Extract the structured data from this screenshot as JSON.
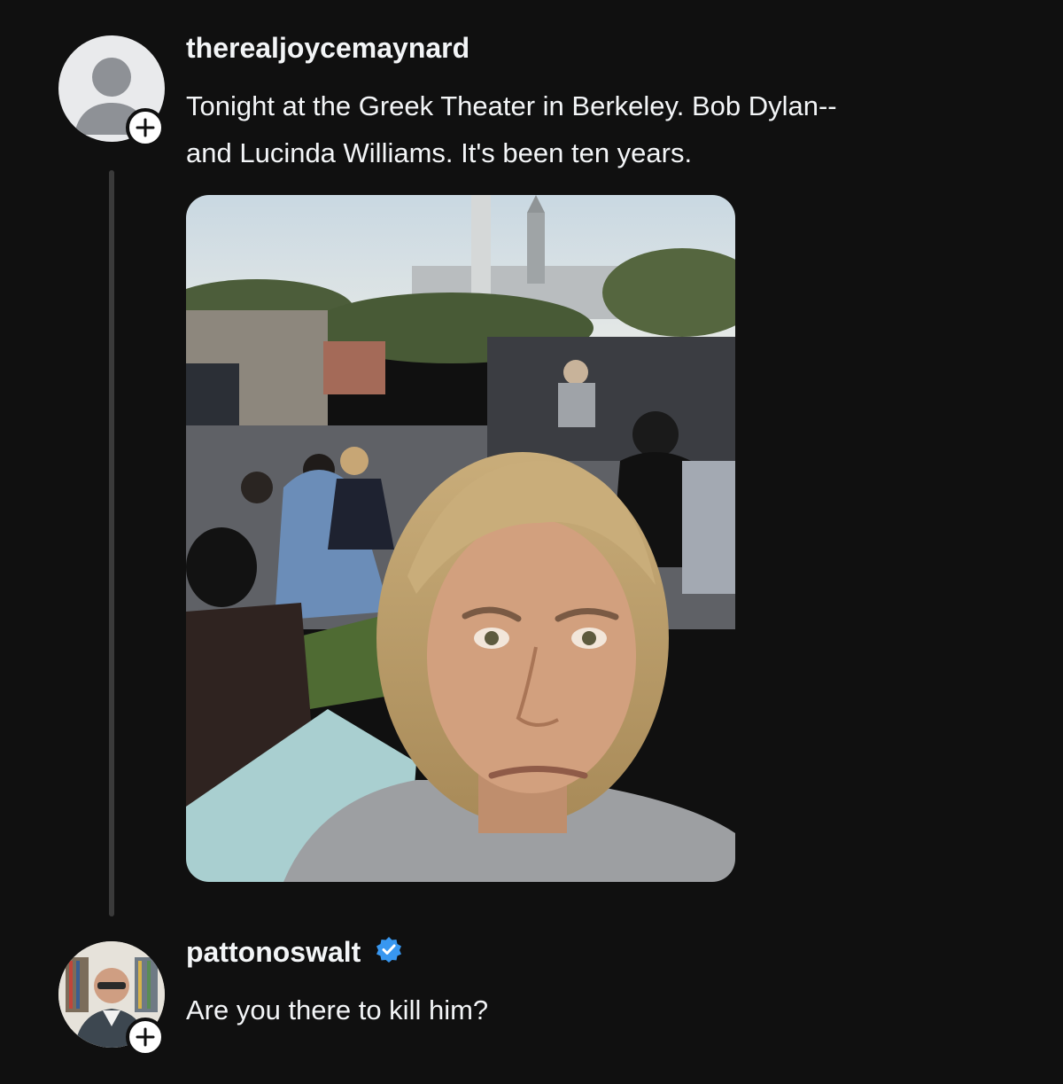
{
  "thread": {
    "original_post": {
      "username": "therealjoycemaynard",
      "text_lines": [
        "Tonight at the Greek Theater in Berkeley. Bob Dylan--",
        "and Lucinda Williams. It's been ten years."
      ],
      "avatar_icon": "default-user-avatar-icon",
      "follow_icon": "plus-icon"
    },
    "reply": {
      "username": "pattonoswalt",
      "verified_icon": "verified-badge-icon",
      "verified_color": "#3897f0",
      "text": "Are you there to kill him?",
      "follow_icon": "plus-icon"
    }
  },
  "colors": {
    "background": "#101010",
    "text": "#f3f5f7",
    "thread_line": "#3a3a3a"
  }
}
